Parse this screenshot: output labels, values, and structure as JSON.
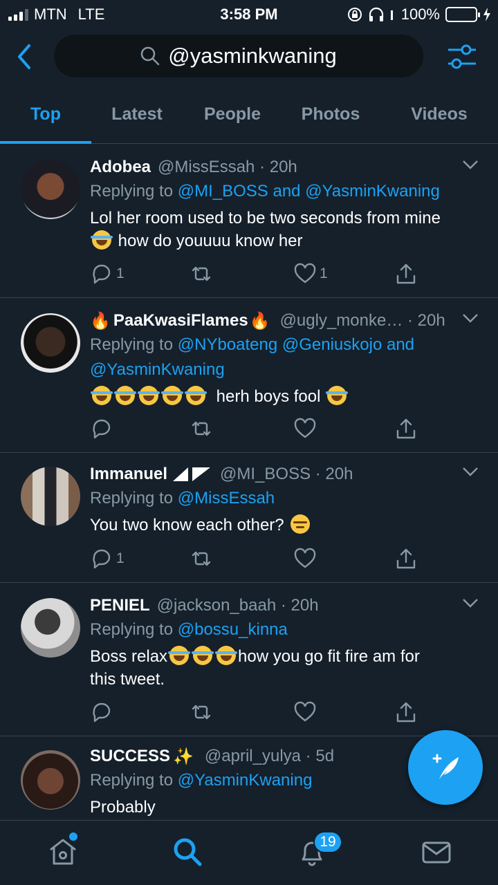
{
  "status_bar": {
    "carrier": "MTN",
    "network": "LTE",
    "time": "3:58 PM",
    "battery": "100%"
  },
  "header": {
    "search_query": "@yasminkwaning"
  },
  "tabs": [
    {
      "label": "Top",
      "active": true
    },
    {
      "label": "Latest",
      "active": false
    },
    {
      "label": "People",
      "active": false
    },
    {
      "label": "Photos",
      "active": false
    },
    {
      "label": "Videos",
      "active": false
    }
  ],
  "tweets": [
    {
      "name": "Adobea",
      "handle": "@MissEssah · 20h",
      "replying_prefix": "Replying to",
      "replying_1": "@MI_BOSS and @YasminKwaning",
      "text_1": "Lol her room used to be two seconds from mine",
      "text_2": "how do youuuu know her",
      "reply_count": "1",
      "like_count": "1"
    },
    {
      "name_prefix_icon": "fire-emoji",
      "name": "PaaKwasiFlames",
      "handle": "@ugly_monke… · 20h",
      "replying_prefix": "Replying to",
      "replying_1": "@NYboateng @Geniuskojo and",
      "replying_2": "@YasminKwaning",
      "text_1": "herh boys fool",
      "reply_count": "",
      "like_count": ""
    },
    {
      "name": "Immanuel",
      "handle": "@MI_BOSS · 20h",
      "replying_prefix": "Replying to",
      "replying_1": "@MissEssah",
      "text_1": "You two know each other?",
      "reply_count": "1",
      "like_count": ""
    },
    {
      "name": "PENIEL",
      "handle": "@jackson_baah · 20h",
      "replying_prefix": "Replying to",
      "replying_1": "@bossu_kinna",
      "text_1": "Boss relax",
      "text_2": "how you go fit fire am for",
      "text_3": "this tweet.",
      "reply_count": "",
      "like_count": ""
    },
    {
      "name": "SUCCESS",
      "handle": "@april_yulya · 5d",
      "replying_prefix": "Replying to",
      "replying_1": "@YasminKwaning",
      "text_1": "Probably"
    }
  ],
  "bottom_nav": {
    "notifications_badge": "19"
  },
  "colors": {
    "background": "#15202b",
    "accent": "#1da1f2",
    "muted": "#8899a6",
    "divider": "#38444d"
  }
}
